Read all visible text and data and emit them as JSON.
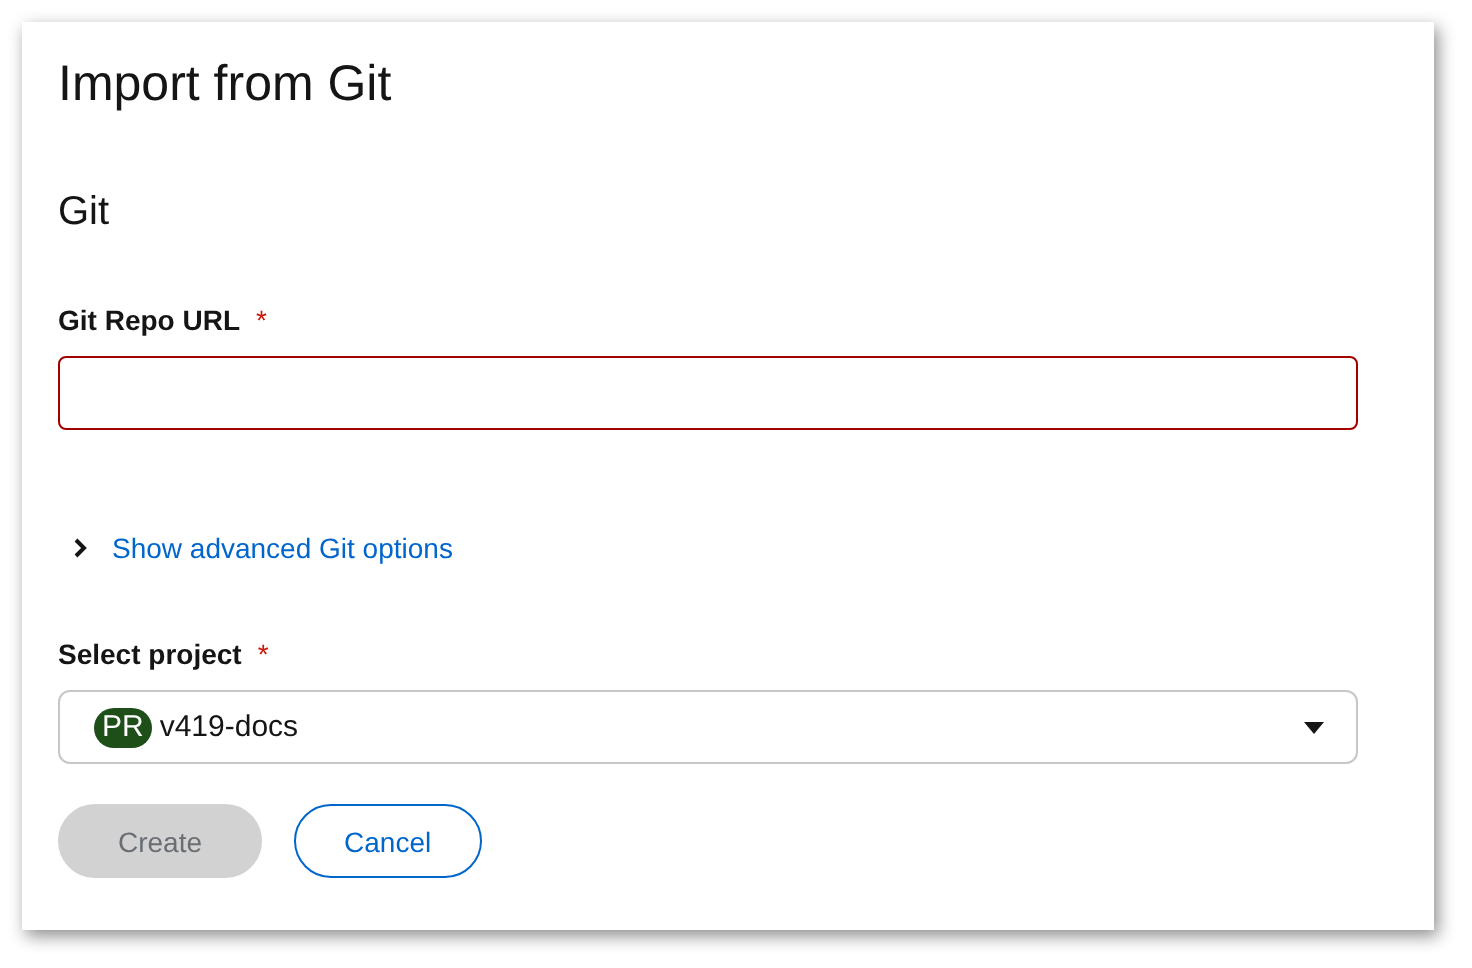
{
  "title": "Import from Git",
  "section": {
    "title": "Git"
  },
  "repo_url": {
    "label": "Git Repo URL",
    "required_mark": "*",
    "invalid": true
  },
  "advanced": {
    "label": "Show advanced Git options",
    "expanded": false
  },
  "project": {
    "label": "Select project",
    "required_mark": "*",
    "badge": {
      "text": "PR",
      "color": "#1e4f18"
    },
    "value": "v419-docs"
  },
  "buttons": [
    {
      "label": "Create",
      "kind": "primary",
      "disabled": true
    },
    {
      "label": "Cancel",
      "kind": "secondary",
      "disabled": false
    }
  ]
}
